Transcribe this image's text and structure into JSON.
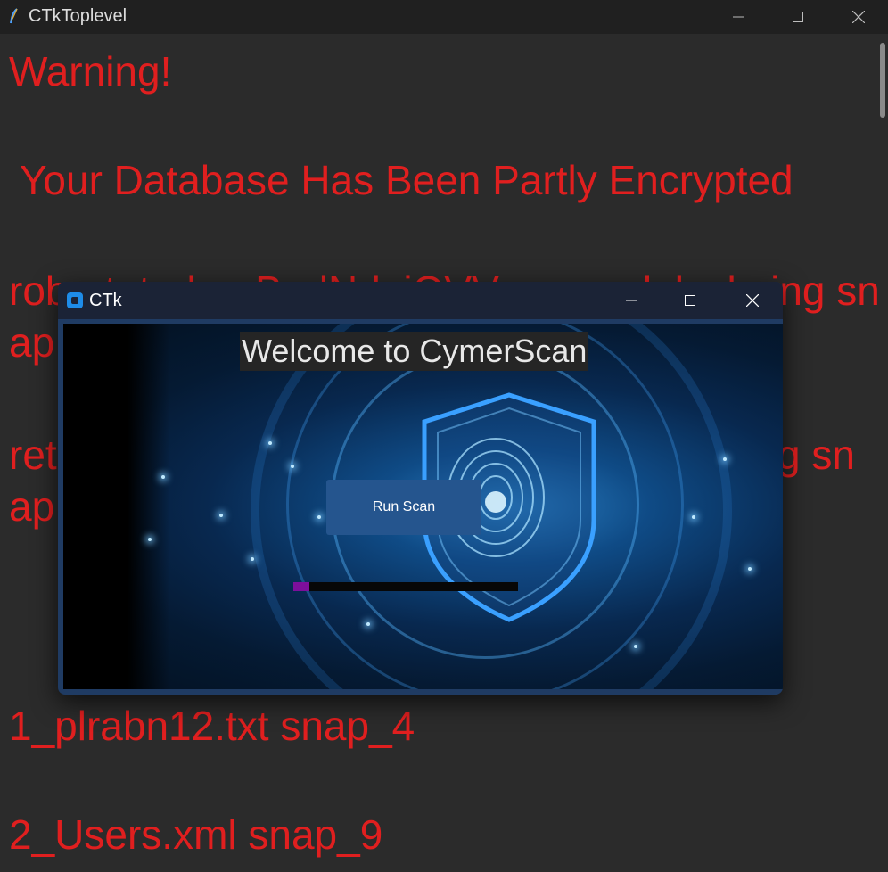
{
  "toplevel": {
    "title": "CTkToplevel",
    "lines": [
      "Warning!",
      " Your Database Has Been Partly Encrypted",
      "robert_tudor_BadNdoiOVVo_...seal_lock_ing sn",
      "ap",
      "ret",
      "g sn",
      "ap",
      "1_plrabn12.txt snap_4",
      "2_Users.xml snap_9"
    ],
    "text_color": "#e01f1f"
  },
  "ctk_window": {
    "title": "CTk",
    "welcome_text": "Welcome to CymerScan",
    "run_scan_label": "Run Scan",
    "progress": 0.07,
    "progress_color": "#7d0f9b",
    "button_color": "#25558e"
  }
}
